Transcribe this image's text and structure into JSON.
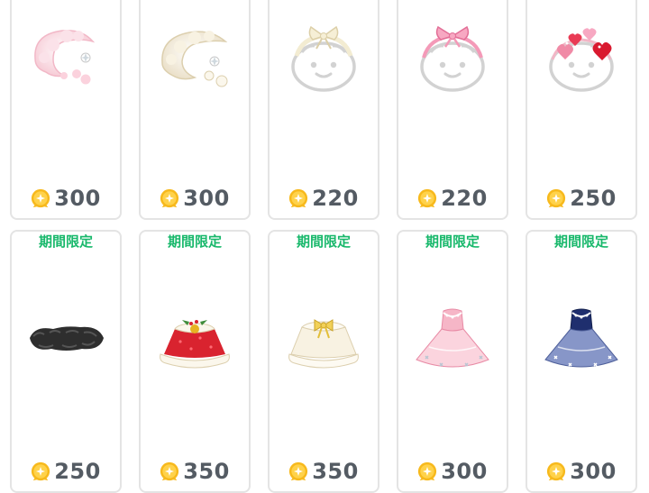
{
  "colors": {
    "limited_label": "#18b86b",
    "price_text": "#545b63",
    "coin": "#f0b418",
    "card_border": "#e4e4e4"
  },
  "rows": [
    {
      "items": [
        {
          "name": "pink fluffy hair accessory",
          "icon": "pink-fur-headpiece-icon",
          "price": "300"
        },
        {
          "name": "white fluffy hair accessory",
          "icon": "white-fur-headpiece-icon",
          "price": "300"
        },
        {
          "name": "cream ribbon headband",
          "icon": "cream-ribbon-headband-icon",
          "price": "220"
        },
        {
          "name": "pink ribbon headband",
          "icon": "pink-ribbon-headband-icon",
          "price": "220"
        },
        {
          "name": "heart headband",
          "icon": "heart-headband-icon",
          "price": "250"
        }
      ]
    },
    {
      "items": [
        {
          "limited": "期間限定",
          "name": "black fur stole",
          "icon": "black-fur-stole-icon",
          "price": "250"
        },
        {
          "limited": "期間限定",
          "name": "red fur cape",
          "icon": "red-fur-cape-icon",
          "price": "350"
        },
        {
          "limited": "期間限定",
          "name": "white fur cape",
          "icon": "white-fur-cape-icon",
          "price": "350"
        },
        {
          "limited": "期間限定",
          "name": "pink tulle dress",
          "icon": "pink-tulle-dress-icon",
          "price": "300"
        },
        {
          "limited": "期間限定",
          "name": "navy tulle dress",
          "icon": "navy-tulle-dress-icon",
          "price": "300"
        }
      ]
    }
  ]
}
